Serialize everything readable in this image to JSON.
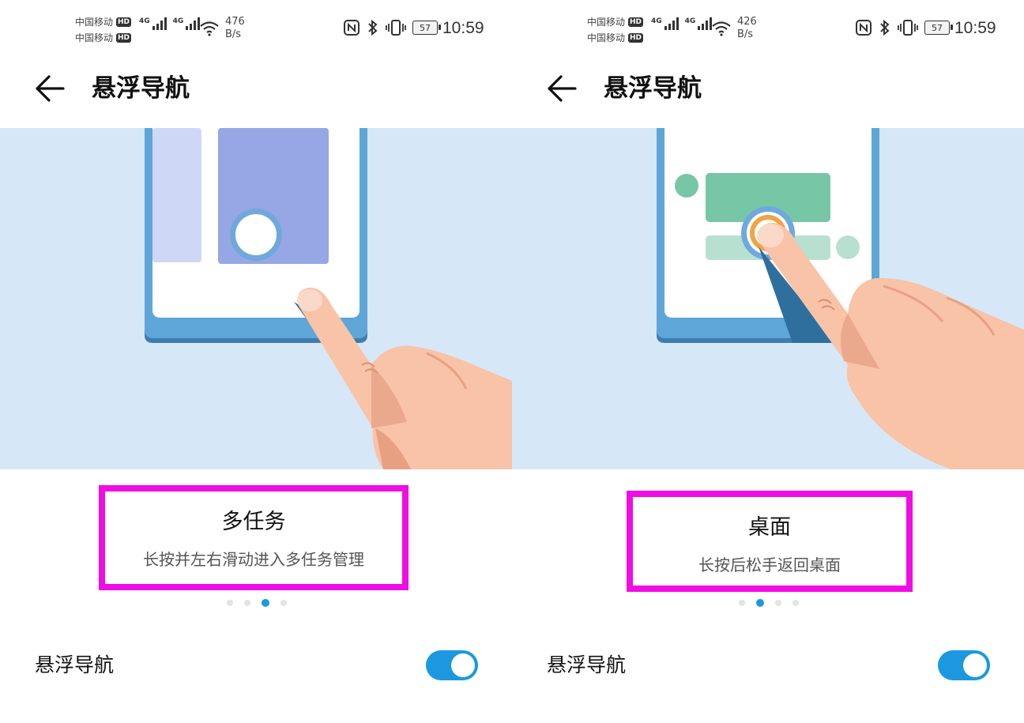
{
  "panels": [
    {
      "status": {
        "carrier1": "中国移动",
        "carrier2": "中国移动",
        "hd": "HD",
        "net": "4G",
        "speed_value": "476",
        "speed_unit": "B/s",
        "battery": "57",
        "time": "10:59"
      },
      "header": {
        "title": "悬浮导航"
      },
      "card": {
        "title": "多任务",
        "description": "长按并左右滑动进入多任务管理"
      },
      "pager": {
        "active_index": 2,
        "count": 4
      },
      "setting": {
        "label": "悬浮导航",
        "enabled": true
      }
    },
    {
      "status": {
        "carrier1": "中国移动",
        "carrier2": "中国移动",
        "hd": "HD",
        "net": "4G",
        "speed_value": "426",
        "speed_unit": "B/s",
        "battery": "57",
        "time": "10:59"
      },
      "header": {
        "title": "悬浮导航"
      },
      "card": {
        "title": "桌面",
        "description": "长按后松手返回桌面"
      },
      "pager": {
        "active_index": 1,
        "count": 4
      },
      "setting": {
        "label": "悬浮导航",
        "enabled": true
      }
    }
  ],
  "colors": {
    "highlight_border": "#f20ce4",
    "accent": "#1b98e0",
    "illustration_bg": "#d6e8f7",
    "phone_frame": "#5ea6d8",
    "recent_card_light": "#cfd7f6",
    "recent_card": "#97a6e4",
    "desktop_block": "#77c6a5",
    "desktop_block_light": "#b8e0d0",
    "float_ring_orange": "#f0a443",
    "hand": "#f8c3a7"
  }
}
